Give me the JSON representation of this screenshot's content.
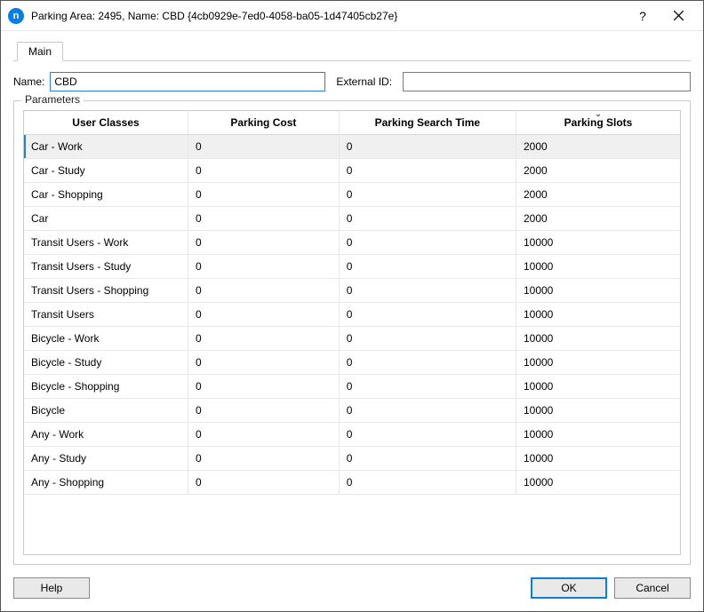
{
  "titlebar": {
    "title": "Parking Area: 2495, Name: CBD  {4cb0929e-7ed0-4058-ba05-1d47405cb27e}",
    "help_tooltip": "?",
    "close_tooltip": "Close"
  },
  "tabs": {
    "main": "Main"
  },
  "form": {
    "name_label": "Name:",
    "name_value": "CBD",
    "external_id_label": "External ID:",
    "external_id_value": ""
  },
  "parameters": {
    "legend": "Parameters",
    "columns": {
      "user_classes": "User Classes",
      "parking_cost": "Parking Cost",
      "parking_search_time": "Parking Search Time",
      "parking_slots": "Parking Slots"
    },
    "rows": [
      {
        "user_class": "Car - Work",
        "cost": "0",
        "search_time": "0",
        "slots": "2000",
        "selected": true
      },
      {
        "user_class": "Car - Study",
        "cost": "0",
        "search_time": "0",
        "slots": "2000"
      },
      {
        "user_class": "Car - Shopping",
        "cost": "0",
        "search_time": "0",
        "slots": "2000"
      },
      {
        "user_class": "Car",
        "cost": "0",
        "search_time": "0",
        "slots": "2000"
      },
      {
        "user_class": "Transit Users - Work",
        "cost": "0",
        "search_time": "0",
        "slots": "10000"
      },
      {
        "user_class": "Transit Users - Study",
        "cost": "0",
        "search_time": "0",
        "slots": "10000"
      },
      {
        "user_class": "Transit Users - Shopping",
        "cost": "0",
        "search_time": "0",
        "slots": "10000"
      },
      {
        "user_class": "Transit Users",
        "cost": "0",
        "search_time": "0",
        "slots": "10000"
      },
      {
        "user_class": "Bicycle - Work",
        "cost": "0",
        "search_time": "0",
        "slots": "10000"
      },
      {
        "user_class": "Bicycle - Study",
        "cost": "0",
        "search_time": "0",
        "slots": "10000"
      },
      {
        "user_class": "Bicycle - Shopping",
        "cost": "0",
        "search_time": "0",
        "slots": "10000"
      },
      {
        "user_class": "Bicycle",
        "cost": "0",
        "search_time": "0",
        "slots": "10000"
      },
      {
        "user_class": "Any - Work",
        "cost": "0",
        "search_time": "0",
        "slots": "10000"
      },
      {
        "user_class": "Any - Study",
        "cost": "0",
        "search_time": "0",
        "slots": "10000"
      },
      {
        "user_class": "Any - Shopping",
        "cost": "0",
        "search_time": "0",
        "slots": "10000"
      }
    ]
  },
  "footer": {
    "help": "Help",
    "ok": "OK",
    "cancel": "Cancel"
  }
}
